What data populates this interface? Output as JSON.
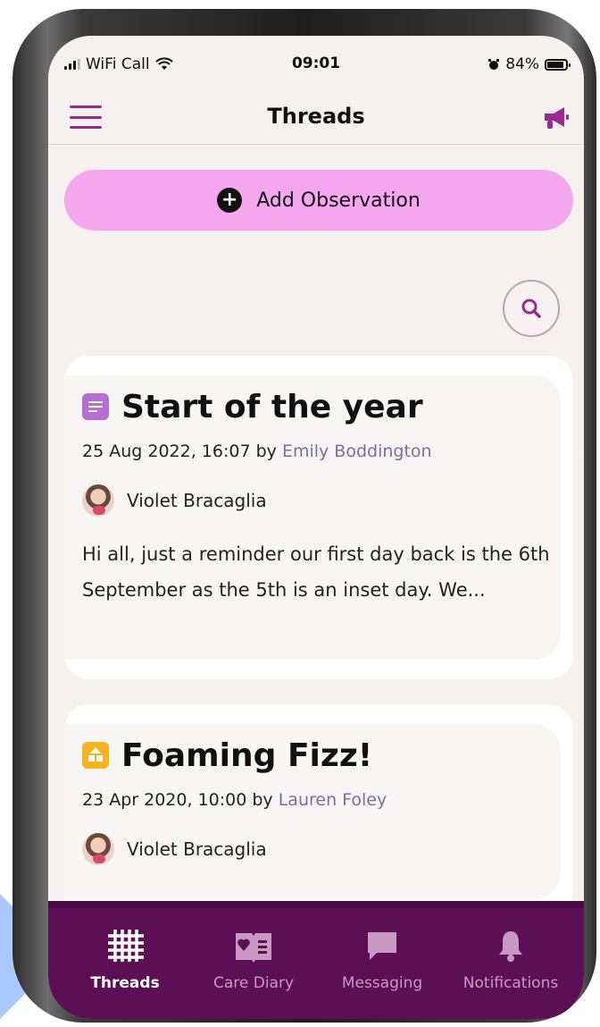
{
  "status_bar": {
    "carrier": "WiFi Call",
    "time": "09:01",
    "battery": "84%",
    "battery_level": 0.84
  },
  "header": {
    "title": "Threads",
    "menu_icon": "hamburger-icon",
    "announce_icon": "megaphone-icon"
  },
  "actions": {
    "add_observation": "Add Observation",
    "search_icon": "search-icon"
  },
  "threads": [
    {
      "icon": "note-icon",
      "icon_color": "#b46fd1",
      "title": "Start of the year",
      "date": "25 Aug 2022, 16:07 by",
      "author": "Emily Boddington",
      "child": "Violet Bracaglia",
      "excerpt": "Hi all, just a reminder our first day back is the 6th September as the 5th is an inset day. We..."
    },
    {
      "icon": "group-activity-icon",
      "icon_color": "#f4b521",
      "title": "Foaming Fizz!",
      "date": "23 Apr 2020, 10:00 by",
      "author": "Lauren Foley",
      "child": "Violet Bracaglia"
    }
  ],
  "bottom_nav": [
    {
      "label": "Threads",
      "icon": "grid-icon",
      "active": true
    },
    {
      "label": "Care Diary",
      "icon": "diary-icon",
      "active": false
    },
    {
      "label": "Messaging",
      "icon": "chat-icon",
      "active": false
    },
    {
      "label": "Notifications",
      "icon": "bell-icon",
      "active": false
    }
  ],
  "colors": {
    "accent": "#9b2a8f",
    "add_button": "#f6a6ef",
    "nav_background": "#5c0f54",
    "author_link": "#7a6fa3",
    "screen_background": "#f5f1ef"
  }
}
